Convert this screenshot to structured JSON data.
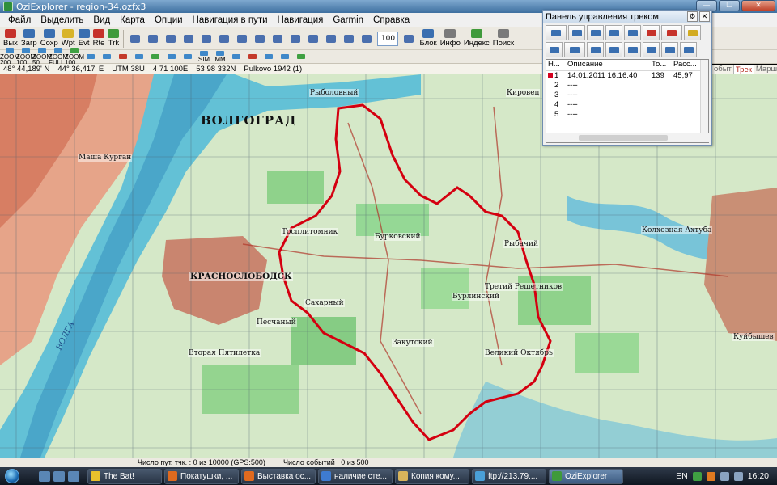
{
  "window": {
    "title": "OziExplorer - region-34.ozfx3",
    "min": "—",
    "max": "☐",
    "close": "✕"
  },
  "menu": [
    "Файл",
    "Выделить",
    "Вид",
    "Карта",
    "Опции",
    "Навигация в пути",
    "Навигация",
    "Garmin",
    "Справка"
  ],
  "toolbar": {
    "buttons": [
      {
        "label": "Вых",
        "icon": "exit-icon",
        "color": "red"
      },
      {
        "label": "Загр",
        "icon": "load-icon",
        "color": "blue"
      },
      {
        "label": "Сохр",
        "icon": "save-icon",
        "color": "blue"
      },
      {
        "label": "Wpt",
        "icon": "waypoint-icon",
        "color": "yellow"
      },
      {
        "label": "Evt",
        "icon": "event-icon",
        "color": "blue"
      },
      {
        "label": "Rte",
        "icon": "route-icon",
        "color": "red"
      },
      {
        "label": "Trk",
        "icon": "track-icon",
        "color": "green"
      }
    ],
    "zoom": "100",
    "right_buttons": [
      {
        "label": "Блок",
        "icon": "block-icon"
      },
      {
        "label": "Инфо",
        "icon": "info-icon"
      },
      {
        "label": "Индекс",
        "icon": "index-icon"
      },
      {
        "label": "Поиск",
        "icon": "search-icon"
      }
    ]
  },
  "toolbar2": {
    "zoom_buttons": [
      "ZOOM 200",
      "ZOOM 100",
      "ZOOM 50",
      "ZOOM FULL",
      "ZOOM 100"
    ],
    "extra": [
      "SIM",
      "MM"
    ]
  },
  "coords": {
    "lat": "48° 44,189' N",
    "lon": "44° 36,417' E",
    "utm": "UTM  38U",
    "easting": "4 71 100E",
    "northing": "53 98 332N",
    "datum": "Pulkovo 1942 (1)"
  },
  "sidetabs": [
    "обыт",
    "Трек",
    "Марш"
  ],
  "track_panel": {
    "title": "Панель управления треком",
    "columns": [
      "Н...",
      "Описание",
      "То...",
      "Расс..."
    ],
    "rows": [
      {
        "n": "1",
        "desc": "14.01.2011 16:16:40",
        "points": "139",
        "dist": "45,97",
        "color": "#d4001f"
      },
      {
        "n": "2",
        "desc": "----"
      },
      {
        "n": "3",
        "desc": "----"
      },
      {
        "n": "4",
        "desc": "----"
      },
      {
        "n": "5",
        "desc": "----"
      }
    ]
  },
  "map": {
    "labels": [
      {
        "text": "ВОЛГОГРАД",
        "kind": "city"
      },
      {
        "text": "КРАСНОСЛОБОДСК",
        "kind": "town"
      },
      {
        "text": "Тосплитомник",
        "kind": "small"
      },
      {
        "text": "Бурковский",
        "kind": "small"
      },
      {
        "text": "Закутский",
        "kind": "small"
      },
      {
        "text": "Вторая Пятилетка",
        "kind": "small"
      },
      {
        "text": "Великий Октябрь",
        "kind": "small"
      },
      {
        "text": "Рыбачий",
        "kind": "small"
      },
      {
        "text": "Кировец",
        "kind": "small"
      },
      {
        "text": "Сахарный",
        "kind": "small"
      },
      {
        "text": "Песчаный",
        "kind": "small"
      },
      {
        "text": "Маша Курган",
        "kind": "small"
      },
      {
        "text": "Куйбышев",
        "kind": "small"
      },
      {
        "text": "Колхозная Ахтуба",
        "kind": "small"
      },
      {
        "text": "Бурлинский",
        "kind": "small"
      },
      {
        "text": "Рыболовный",
        "kind": "small"
      },
      {
        "text": "Третий Решетников",
        "kind": "small"
      },
      {
        "text": "ВОЛГА",
        "kind": "river"
      }
    ]
  },
  "status": {
    "points": "Число пут. тчк. : 0 из 10000  (GPS:500)",
    "events": "Число событий : 0 из 500"
  },
  "taskbar": {
    "items": [
      {
        "label": "The Bat!",
        "color": "#e8c12c"
      },
      {
        "label": "Покатушки, ...",
        "color": "#e06a1e"
      },
      {
        "label": "Выставка ос...",
        "color": "#e06a1e"
      },
      {
        "label": "наличие сте...",
        "color": "#3e7bd0"
      },
      {
        "label": "Копия кому...",
        "color": "#d8b45b"
      },
      {
        "label": "ftp://213.79....",
        "color": "#4aa0d8"
      },
      {
        "label": "OziExplorer",
        "color": "#3f9a3b"
      }
    ],
    "lang": "EN",
    "clock": "16:20"
  }
}
